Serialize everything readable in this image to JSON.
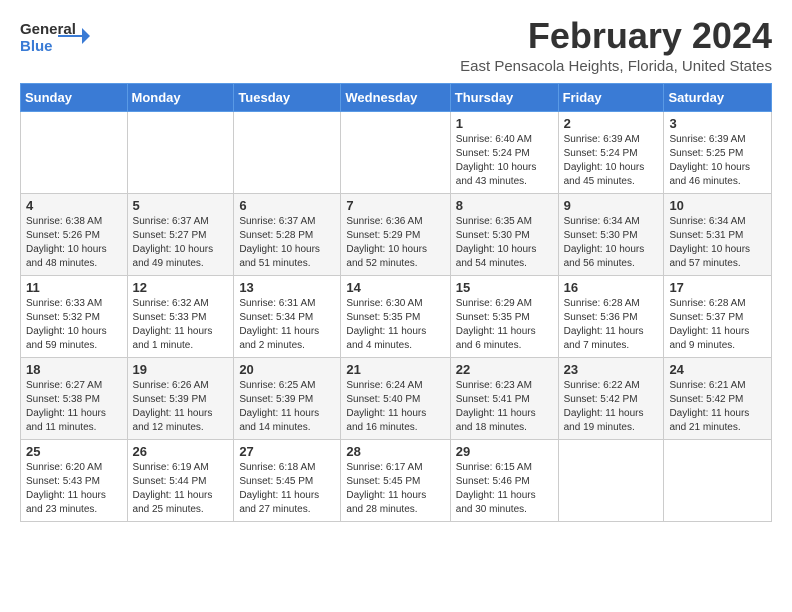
{
  "logo": {
    "text_general": "General",
    "text_blue": "Blue",
    "arrow_color": "#3a7bd5"
  },
  "title": "February 2024",
  "subtitle": "East Pensacola Heights, Florida, United States",
  "header_color": "#3a7bd5",
  "days_of_week": [
    "Sunday",
    "Monday",
    "Tuesday",
    "Wednesday",
    "Thursday",
    "Friday",
    "Saturday"
  ],
  "weeks": [
    [
      {
        "day": "",
        "info": ""
      },
      {
        "day": "",
        "info": ""
      },
      {
        "day": "",
        "info": ""
      },
      {
        "day": "",
        "info": ""
      },
      {
        "day": "1",
        "info": "Sunrise: 6:40 AM\nSunset: 5:24 PM\nDaylight: 10 hours\nand 43 minutes."
      },
      {
        "day": "2",
        "info": "Sunrise: 6:39 AM\nSunset: 5:24 PM\nDaylight: 10 hours\nand 45 minutes."
      },
      {
        "day": "3",
        "info": "Sunrise: 6:39 AM\nSunset: 5:25 PM\nDaylight: 10 hours\nand 46 minutes."
      }
    ],
    [
      {
        "day": "4",
        "info": "Sunrise: 6:38 AM\nSunset: 5:26 PM\nDaylight: 10 hours\nand 48 minutes."
      },
      {
        "day": "5",
        "info": "Sunrise: 6:37 AM\nSunset: 5:27 PM\nDaylight: 10 hours\nand 49 minutes."
      },
      {
        "day": "6",
        "info": "Sunrise: 6:37 AM\nSunset: 5:28 PM\nDaylight: 10 hours\nand 51 minutes."
      },
      {
        "day": "7",
        "info": "Sunrise: 6:36 AM\nSunset: 5:29 PM\nDaylight: 10 hours\nand 52 minutes."
      },
      {
        "day": "8",
        "info": "Sunrise: 6:35 AM\nSunset: 5:30 PM\nDaylight: 10 hours\nand 54 minutes."
      },
      {
        "day": "9",
        "info": "Sunrise: 6:34 AM\nSunset: 5:30 PM\nDaylight: 10 hours\nand 56 minutes."
      },
      {
        "day": "10",
        "info": "Sunrise: 6:34 AM\nSunset: 5:31 PM\nDaylight: 10 hours\nand 57 minutes."
      }
    ],
    [
      {
        "day": "11",
        "info": "Sunrise: 6:33 AM\nSunset: 5:32 PM\nDaylight: 10 hours\nand 59 minutes."
      },
      {
        "day": "12",
        "info": "Sunrise: 6:32 AM\nSunset: 5:33 PM\nDaylight: 11 hours\nand 1 minute."
      },
      {
        "day": "13",
        "info": "Sunrise: 6:31 AM\nSunset: 5:34 PM\nDaylight: 11 hours\nand 2 minutes."
      },
      {
        "day": "14",
        "info": "Sunrise: 6:30 AM\nSunset: 5:35 PM\nDaylight: 11 hours\nand 4 minutes."
      },
      {
        "day": "15",
        "info": "Sunrise: 6:29 AM\nSunset: 5:35 PM\nDaylight: 11 hours\nand 6 minutes."
      },
      {
        "day": "16",
        "info": "Sunrise: 6:28 AM\nSunset: 5:36 PM\nDaylight: 11 hours\nand 7 minutes."
      },
      {
        "day": "17",
        "info": "Sunrise: 6:28 AM\nSunset: 5:37 PM\nDaylight: 11 hours\nand 9 minutes."
      }
    ],
    [
      {
        "day": "18",
        "info": "Sunrise: 6:27 AM\nSunset: 5:38 PM\nDaylight: 11 hours\nand 11 minutes."
      },
      {
        "day": "19",
        "info": "Sunrise: 6:26 AM\nSunset: 5:39 PM\nDaylight: 11 hours\nand 12 minutes."
      },
      {
        "day": "20",
        "info": "Sunrise: 6:25 AM\nSunset: 5:39 PM\nDaylight: 11 hours\nand 14 minutes."
      },
      {
        "day": "21",
        "info": "Sunrise: 6:24 AM\nSunset: 5:40 PM\nDaylight: 11 hours\nand 16 minutes."
      },
      {
        "day": "22",
        "info": "Sunrise: 6:23 AM\nSunset: 5:41 PM\nDaylight: 11 hours\nand 18 minutes."
      },
      {
        "day": "23",
        "info": "Sunrise: 6:22 AM\nSunset: 5:42 PM\nDaylight: 11 hours\nand 19 minutes."
      },
      {
        "day": "24",
        "info": "Sunrise: 6:21 AM\nSunset: 5:42 PM\nDaylight: 11 hours\nand 21 minutes."
      }
    ],
    [
      {
        "day": "25",
        "info": "Sunrise: 6:20 AM\nSunset: 5:43 PM\nDaylight: 11 hours\nand 23 minutes."
      },
      {
        "day": "26",
        "info": "Sunrise: 6:19 AM\nSunset: 5:44 PM\nDaylight: 11 hours\nand 25 minutes."
      },
      {
        "day": "27",
        "info": "Sunrise: 6:18 AM\nSunset: 5:45 PM\nDaylight: 11 hours\nand 27 minutes."
      },
      {
        "day": "28",
        "info": "Sunrise: 6:17 AM\nSunset: 5:45 PM\nDaylight: 11 hours\nand 28 minutes."
      },
      {
        "day": "29",
        "info": "Sunrise: 6:15 AM\nSunset: 5:46 PM\nDaylight: 11 hours\nand 30 minutes."
      },
      {
        "day": "",
        "info": ""
      },
      {
        "day": "",
        "info": ""
      }
    ]
  ]
}
